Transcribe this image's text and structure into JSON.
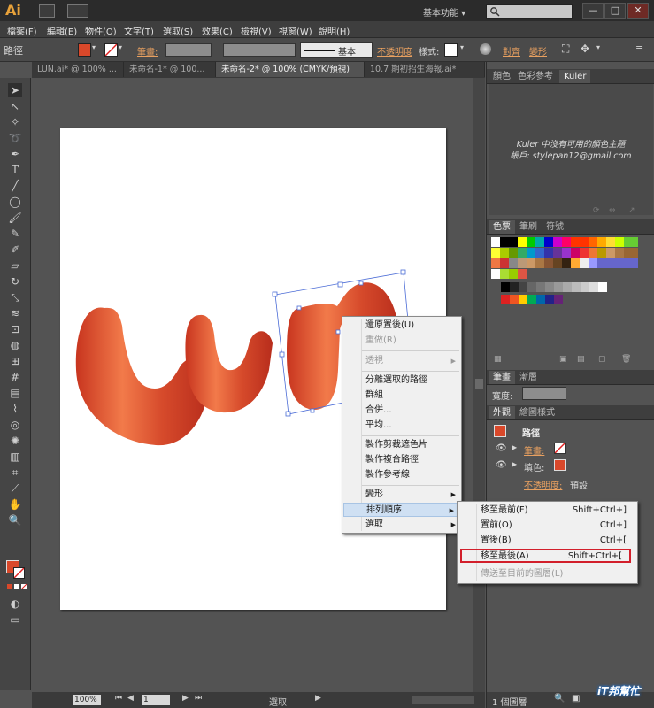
{
  "app": {
    "logo": "Ai",
    "workspace": "基本功能",
    "colors": {
      "accent": "#e8a23a",
      "fill": "#d9482a"
    }
  },
  "window_controls": {
    "minimize": "—",
    "maximize": "□",
    "close": "✕"
  },
  "menubar": [
    "檔案(F)",
    "編輯(E)",
    "物件(O)",
    "文字(T)",
    "選取(S)",
    "效果(C)",
    "檢視(V)",
    "視窗(W)",
    "說明(H)"
  ],
  "control": {
    "object_type": "路徑",
    "stroke_label": "筆畫:",
    "stroke_style": "基本",
    "opacity_label": "不透明度",
    "style_label": "樣式:",
    "align_label": "對齊",
    "transform_label": "變形"
  },
  "tabs": [
    "LUN.ai* @ 100% ...",
    "未命名-1* @ 100...",
    "未命名-2* @ 100% (CMYK/預視)",
    "10.7 期初招生海報.ai*"
  ],
  "status": {
    "zoom": "100%",
    "page": "1",
    "mode": "選取"
  },
  "panels": {
    "color_tabs": [
      "顏色",
      "色彩參考",
      "Kuler"
    ],
    "kuler_message": "Kuler 中沒有可用的顏色主題",
    "kuler_account": "帳戶: stylepan12@gmail.com",
    "swatch_tabs": [
      "色票",
      "筆刷",
      "符號"
    ],
    "stroke_tabs": [
      "筆畫",
      "漸層"
    ],
    "width_label": "寬度:",
    "appearance_tabs": [
      "外觀",
      "繪圖樣式"
    ],
    "appearance_title": "路徑",
    "appearance_rows": [
      "筆畫:",
      "填色:",
      "不透明度:"
    ],
    "opacity_value": "預設",
    "layers_count": "1 個圖層"
  },
  "context_menu": {
    "items": [
      {
        "label": "還原置後(U)",
        "enabled": true
      },
      {
        "label": "重做(R)",
        "enabled": false
      },
      {
        "label": "透視",
        "enabled": false,
        "submenu": true
      },
      {
        "label": "分離選取的路徑",
        "enabled": true
      },
      {
        "label": "群組",
        "enabled": true
      },
      {
        "label": "合併...",
        "enabled": true
      },
      {
        "label": "平均...",
        "enabled": true
      },
      {
        "label": "製作剪裁遮色片",
        "enabled": true
      },
      {
        "label": "製作複合路徑",
        "enabled": true
      },
      {
        "label": "製作參考線",
        "enabled": true
      },
      {
        "label": "變形",
        "enabled": true,
        "submenu": true
      },
      {
        "label": "排列順序",
        "enabled": true,
        "submenu": true,
        "highlighted": true
      },
      {
        "label": "選取",
        "enabled": true,
        "submenu": true
      }
    ]
  },
  "submenu": {
    "items": [
      {
        "label": "移至最前(F)",
        "shortcut": "Shift+Ctrl+]",
        "enabled": true
      },
      {
        "label": "置前(O)",
        "shortcut": "Ctrl+]",
        "enabled": true
      },
      {
        "label": "置後(B)",
        "shortcut": "Ctrl+[",
        "enabled": true
      },
      {
        "label": "移至最後(A)",
        "shortcut": "Shift+Ctrl+[",
        "enabled": true,
        "outlined": true
      },
      {
        "label": "傳送至目前的圖層(L)",
        "shortcut": "",
        "enabled": false
      }
    ]
  },
  "watermark": "iT邦幫忙"
}
